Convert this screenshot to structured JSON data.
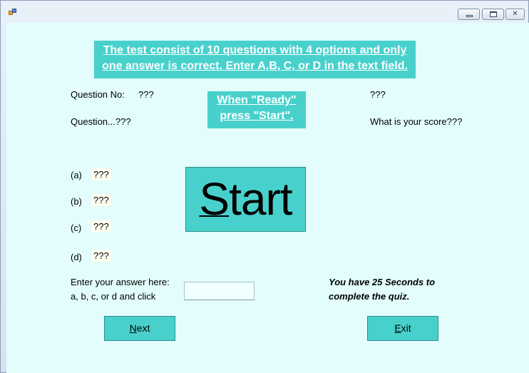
{
  "window": {
    "min_glyph": "",
    "max_glyph": "",
    "close_glyph": "✕"
  },
  "banner": {
    "line1": "The test consist of 10 questions with 4 options and only",
    "line2": "one answer is correct. Enter A,B, C, or D in the text field."
  },
  "ready": {
    "line1": "When \"Ready\"",
    "line2": "press \"Start\"."
  },
  "question": {
    "number_label": "Question No:",
    "number_value": "???",
    "text_label": "Question...???"
  },
  "score": {
    "top_value": "???",
    "label": "What is your score???"
  },
  "options": [
    {
      "label": "(a)",
      "value": "???"
    },
    {
      "label": "(b)",
      "value": "???"
    },
    {
      "label": "(c)",
      "value": "???"
    },
    {
      "label": "(d)",
      "value": "???"
    }
  ],
  "start_button": {
    "mnemonic": "S",
    "rest": "tart"
  },
  "answer": {
    "line1": "Enter your answer here:",
    "line2": "a, b, c, or d and click",
    "value": ""
  },
  "timer": {
    "line1": "You have 25 Seconds to",
    "line2": "complete the quiz."
  },
  "next_button": {
    "mnemonic": "N",
    "rest": "ext"
  },
  "exit_button": {
    "mnemonic": "E",
    "rest": "xit"
  }
}
